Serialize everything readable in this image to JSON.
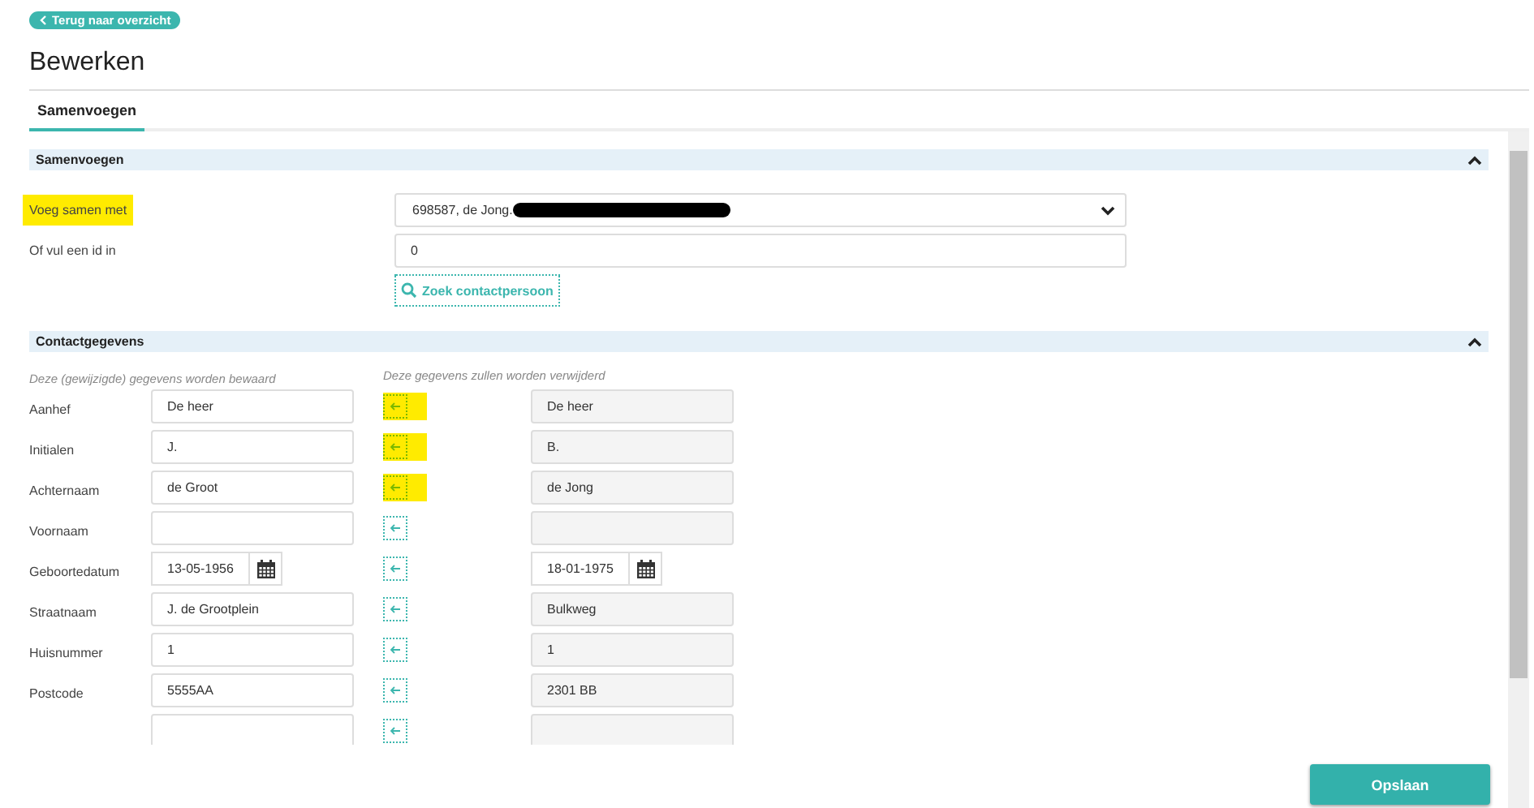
{
  "back_link": "Terug naar overzicht",
  "title": "Bewerken",
  "tabs": [
    {
      "label": "Samenvoegen",
      "selected": true
    }
  ],
  "merge_section": {
    "title": "Samenvoegen",
    "expanded": true,
    "merge_with": {
      "label": "Voeg samen met",
      "highlighted": true,
      "value": "698587, de Jong.",
      "redacted": true
    },
    "id_field": {
      "label": "Of vul een id in",
      "value": "0"
    },
    "search_button": "Zoek contactpersoon"
  },
  "contact_section": {
    "title": "Contactgegevens",
    "expanded": true,
    "keep_heading": "Deze (gewijzigde) gegevens worden bewaard",
    "remove_heading": "Deze gegevens zullen worden verwijderd",
    "rows": [
      {
        "label": "Aanhef",
        "kind": "text",
        "keep": "De heer",
        "remove": "De heer",
        "highlighted": true
      },
      {
        "label": "Initialen",
        "kind": "text",
        "keep": "J.",
        "remove": "B.",
        "highlighted": true
      },
      {
        "label": "Achternaam",
        "kind": "text",
        "keep": "de Groot",
        "remove": "de Jong",
        "highlighted": true
      },
      {
        "label": "Voornaam",
        "kind": "text",
        "keep": "",
        "remove": "",
        "highlighted": false
      },
      {
        "label": "Geboortedatum",
        "kind": "date",
        "keep": "13-05-1956",
        "remove": "18-01-1975",
        "highlighted": false
      },
      {
        "label": "Straatnaam",
        "kind": "text",
        "keep": "J. de Grootplein",
        "remove": "Bulkweg",
        "highlighted": false
      },
      {
        "label": "Huisnummer",
        "kind": "text",
        "keep": "1",
        "remove": "1",
        "highlighted": false
      },
      {
        "label": "Postcode",
        "kind": "text",
        "keep": "5555AA",
        "remove": "2301 BB",
        "highlighted": false
      },
      {
        "label": "",
        "kind": "text",
        "keep": "",
        "remove": "",
        "highlighted": false
      }
    ]
  },
  "save_button": "Opslaan"
}
